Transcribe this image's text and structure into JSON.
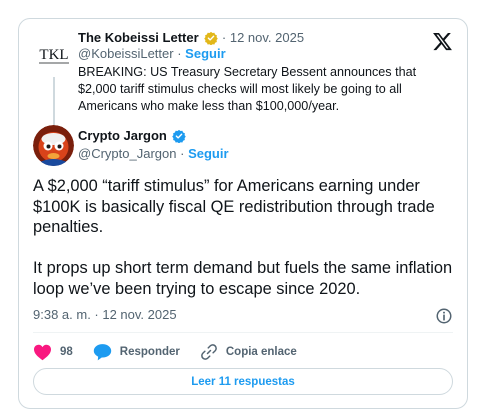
{
  "parent_tweet": {
    "avatar_text": "TKL",
    "name": "The Kobeissi Letter",
    "date": "12 nov. 2025",
    "handle": "@KobeissiLetter",
    "follow_label": "Seguir",
    "text": "BREAKING: US Treasury Secretary Bessent announces that $2,000 tariff stimulus checks will most likely be going to all Americans who make less than $100,000/year."
  },
  "main_tweet": {
    "name": "Crypto Jargon",
    "handle": "@Crypto_Jargon",
    "follow_label": "Seguir",
    "paragraphs": [
      "A $2,000 “tariff stimulus” for Americans earning under $100K is basically fiscal QE redistribution through trade penalties.",
      "It props up short term demand but fuels the same inflation loop we’ve been trying to escape since 2020."
    ],
    "timestamp": "9:38 a. m. · 12 nov. 2025"
  },
  "actions": {
    "likes": "98",
    "reply_label": "Responder",
    "copy_link_label": "Copia enlace"
  },
  "read_replies_label": "Leer 11 respuestas",
  "separator": "·",
  "colors": {
    "accent": "#1d9bf0",
    "like": "#f91880",
    "gold_badge": "#e2b719",
    "secondary_text": "#536471"
  }
}
